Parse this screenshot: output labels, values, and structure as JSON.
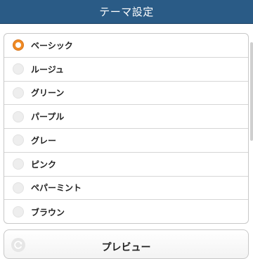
{
  "header": {
    "title": "テーマ設定"
  },
  "theme_list": {
    "selected_index": 0,
    "items": [
      {
        "label": "ベーシック"
      },
      {
        "label": "ルージュ"
      },
      {
        "label": "グリーン"
      },
      {
        "label": "パープル"
      },
      {
        "label": "グレー"
      },
      {
        "label": "ピンク"
      },
      {
        "label": "ペパーミント"
      },
      {
        "label": "ブラウン"
      }
    ]
  },
  "preview": {
    "label": "プレビュー",
    "icon": "refresh-icon"
  },
  "colors": {
    "header_bg": "#2a5b86",
    "selected_radio": "#f08a24",
    "unselected_radio": "#eeeeee"
  }
}
